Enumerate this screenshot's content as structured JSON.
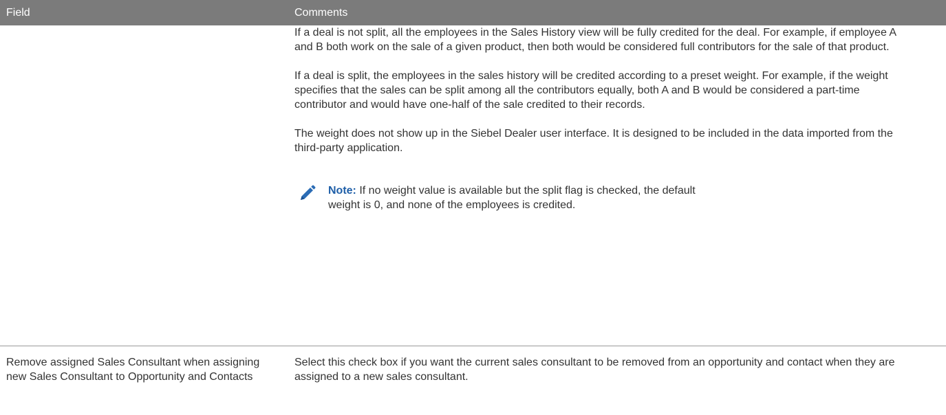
{
  "header": {
    "field_label": "Field",
    "comments_label": "Comments"
  },
  "rows": [
    {
      "field": "",
      "paragraphs": [
        "If a deal is not split, all the employees in the Sales History view will be fully credited for the deal. For example, if employee A and B both work on the sale of a given product, then both would be considered full contributors for the sale of that product.",
        "If a deal is split, the employees in the sales history will be credited according to a preset weight. For example, if the weight specifies that the sales can be split among all the contributors equally, both A and B would be considered a part-time contributor and would have one-half of the sale credited to their records.",
        "The weight does not show up in the Siebel Dealer user interface. It is designed to be included in the data imported from the third-party application."
      ],
      "note": {
        "icon": "pencil-icon",
        "label": "Note:",
        "text": " If no weight value is available but the split flag is checked, the default weight is 0, and none of the employees is credited."
      }
    },
    {
      "field": "Remove assigned Sales Consultant when assigning new Sales Consultant to Opportunity and Contacts",
      "comment": "Select this check box if you want the current sales consultant to be removed from an opportunity and contact when they are assigned to a new sales consultant."
    }
  ],
  "colors": {
    "header_bg": "#7b7b7b",
    "note_label": "#1f5fa8",
    "icon": "#2b6cb5"
  }
}
